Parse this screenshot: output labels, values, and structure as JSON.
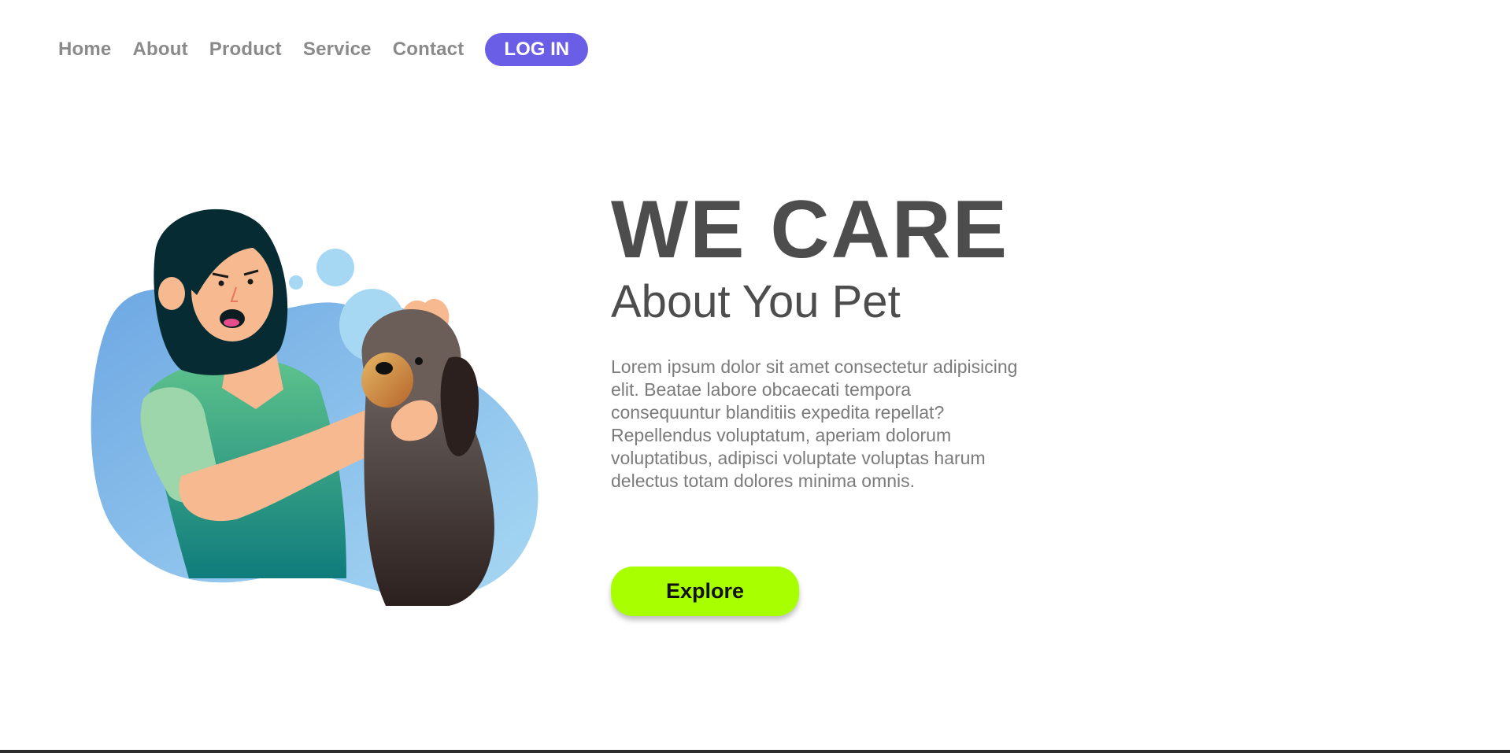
{
  "nav": {
    "items": [
      {
        "label": "Home"
      },
      {
        "label": "About"
      },
      {
        "label": "Product"
      },
      {
        "label": "Service"
      },
      {
        "label": "Contact"
      }
    ],
    "login_label": "LOG IN"
  },
  "hero": {
    "title": "WE CARE",
    "subtitle": "About You Pet",
    "text": "Lorem ipsum dolor sit amet consectetur adipisicing elit. Beatae labore obcaecati tempora consequuntur blanditiis expedita repellat? Repellendus voluptatum, aperiam dolorum voluptatibus, adipisci voluptate voluptas harum delectus totam dolores minima omnis.",
    "button_label": "Explore"
  },
  "colors": {
    "accent": "#6b5ee6",
    "button": "#a8ff00",
    "heading": "#4d4d4d",
    "nav_text": "#8a8a8a"
  },
  "icons": {
    "illustration": "woman-caring-for-dog-illustration"
  }
}
